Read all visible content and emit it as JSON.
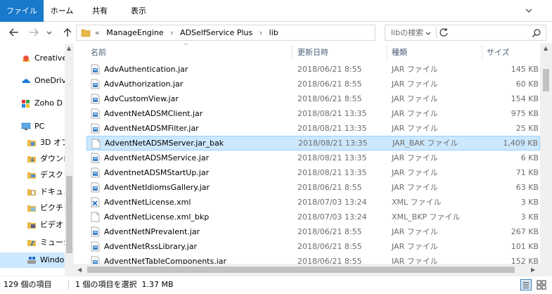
{
  "ribbon": {
    "tabs": [
      "ファイル",
      "ホーム",
      "共有",
      "表示"
    ]
  },
  "address": {
    "crumbs": [
      "«",
      "ManageEngine",
      "›",
      "ADSelfService Plus",
      "›",
      "lib"
    ],
    "search_placeholder": "libの検索"
  },
  "nav": {
    "items": [
      {
        "label": "Creative",
        "icon": "creative-cloud-icon"
      },
      {
        "label": "OneDriv",
        "icon": "onedrive-cloud-icon"
      },
      {
        "label": "Zoho D",
        "icon": "zoho-docs-icon"
      },
      {
        "label": "PC",
        "icon": "computer-icon"
      },
      {
        "label": "3D オブ",
        "icon": "3d-objects-folder-icon"
      },
      {
        "label": "ダウンロ",
        "icon": "downloads-folder-icon"
      },
      {
        "label": "デスクト",
        "icon": "desktop-folder-icon"
      },
      {
        "label": "ドキュメ",
        "icon": "documents-folder-icon"
      },
      {
        "label": "ピクチャ",
        "icon": "pictures-folder-icon"
      },
      {
        "label": "ビデオ",
        "icon": "videos-folder-icon"
      },
      {
        "label": "ミュージ",
        "icon": "music-folder-icon"
      },
      {
        "label": "Windo",
        "icon": "windows-drive-icon"
      }
    ]
  },
  "columns": {
    "name": "名前",
    "date": "更新日時",
    "type": "種類",
    "size": "サイズ"
  },
  "files": [
    {
      "name": "AdvAuthentication.jar",
      "date": "2018/06/21 8:55",
      "type": "JAR ファイル",
      "size": "145 KB",
      "kind": "jar"
    },
    {
      "name": "AdvAuthorization.jar",
      "date": "2018/06/21 8:55",
      "type": "JAR ファイル",
      "size": "60 KB",
      "kind": "jar"
    },
    {
      "name": "AdvCustomView.jar",
      "date": "2018/06/21 8:55",
      "type": "JAR ファイル",
      "size": "154 KB",
      "kind": "jar"
    },
    {
      "name": "AdventNetADSMClient.jar",
      "date": "2018/08/21 13:35",
      "type": "JAR ファイル",
      "size": "975 KB",
      "kind": "jar"
    },
    {
      "name": "AdventNetADSMFilter.jar",
      "date": "2018/08/21 13:35",
      "type": "JAR ファイル",
      "size": "25 KB",
      "kind": "jar"
    },
    {
      "name": "AdventNetADSMServer.jar_bak",
      "date": "2018/08/21 13:35",
      "type": "JAR_BAK ファイル",
      "size": "1,409 KB",
      "kind": "blank",
      "selected": true
    },
    {
      "name": "AdventNetADSMService.jar",
      "date": "2018/08/21 13:35",
      "type": "JAR ファイル",
      "size": "6 KB",
      "kind": "jar"
    },
    {
      "name": "AdventnetADSMStartUp.jar",
      "date": "2018/08/21 13:35",
      "type": "JAR ファイル",
      "size": "71 KB",
      "kind": "jar"
    },
    {
      "name": "AdventNetIdiomsGallery.jar",
      "date": "2018/06/21 8:55",
      "type": "JAR ファイル",
      "size": "63 KB",
      "kind": "jar"
    },
    {
      "name": "AdventNetLicense.xml",
      "date": "2018/07/03 13:24",
      "type": "XML ファイル",
      "size": "3 KB",
      "kind": "xml"
    },
    {
      "name": "AdventNetLicense.xml_bkp",
      "date": "2018/07/03 13:24",
      "type": "XML_BKP ファイル",
      "size": "3 KB",
      "kind": "blank"
    },
    {
      "name": "AdventNetNPrevalent.jar",
      "date": "2018/06/21 8:55",
      "type": "JAR ファイル",
      "size": "267 KB",
      "kind": "jar"
    },
    {
      "name": "AdventNetRssLibrary.jar",
      "date": "2018/06/21 8:55",
      "type": "JAR ファイル",
      "size": "101 KB",
      "kind": "jar"
    },
    {
      "name": "AdventNetTableComponents.jar",
      "date": "2018/06/21 8:55",
      "type": "JAR ファイル",
      "size": "152 KB",
      "kind": "jar"
    }
  ],
  "status": {
    "count": "129 個の項目",
    "selection": "1 個の項目を選択  1.37 MB"
  },
  "colors": {
    "accent": "#1979ca",
    "selection": "#cce8ff",
    "selection_border": "#99d1ff"
  }
}
